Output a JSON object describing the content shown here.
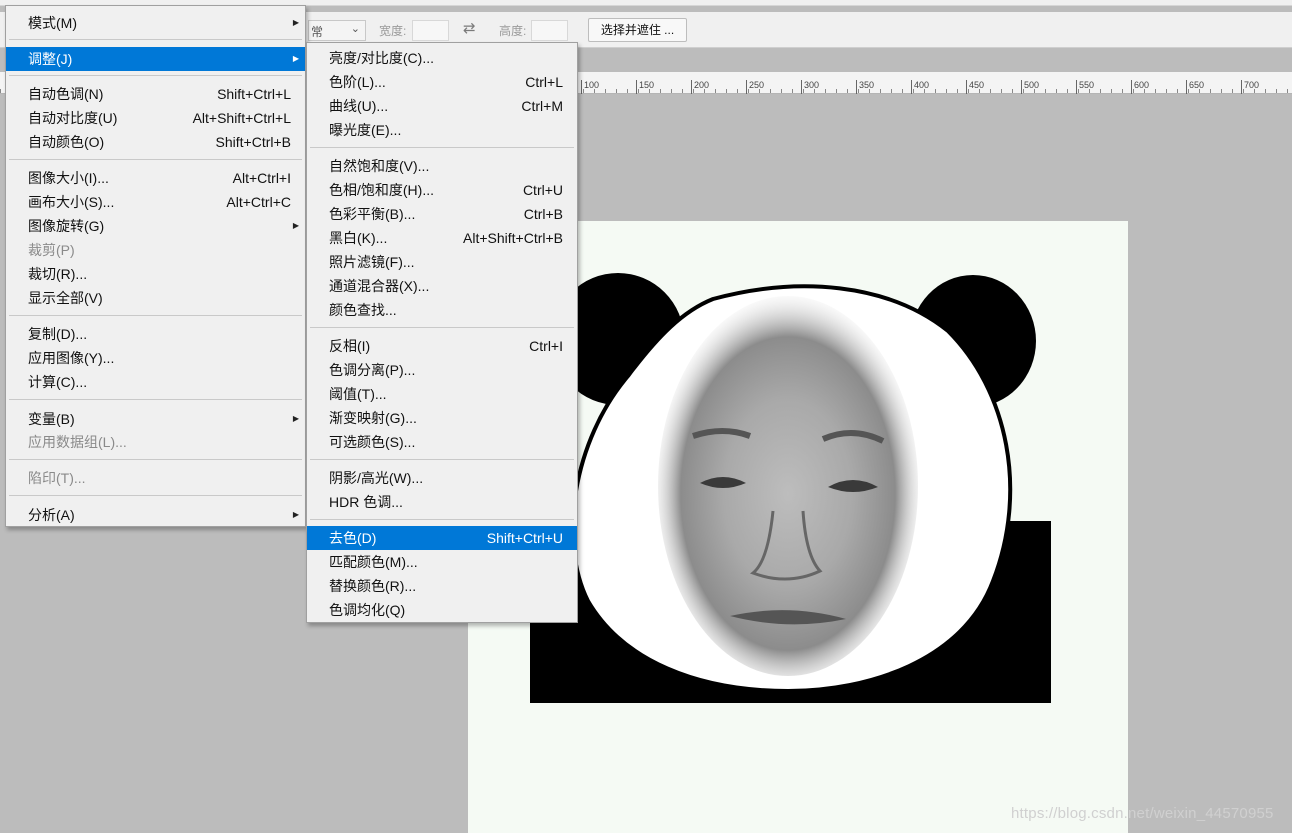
{
  "options_bar": {
    "style_value": "常",
    "width_label": "宽度:",
    "height_label": "高度:",
    "select_mask_button": "选择并遮住 ..."
  },
  "ruler": {
    "ticks": [
      "100",
      "150",
      "200",
      "250",
      "300",
      "350",
      "400",
      "450",
      "500",
      "550",
      "600",
      "650",
      "700"
    ]
  },
  "image_menu": {
    "items": [
      {
        "label": "模式(M)",
        "shortcut": "",
        "submenu": true,
        "disabled": false,
        "highlighted": false
      },
      {
        "label": "调整(J)",
        "shortcut": "",
        "submenu": true,
        "disabled": false,
        "highlighted": true
      },
      {
        "label": "自动色调(N)",
        "shortcut": "Shift+Ctrl+L",
        "submenu": false,
        "disabled": false,
        "highlighted": false
      },
      {
        "label": "自动对比度(U)",
        "shortcut": "Alt+Shift+Ctrl+L",
        "submenu": false,
        "disabled": false,
        "highlighted": false
      },
      {
        "label": "自动颜色(O)",
        "shortcut": "Shift+Ctrl+B",
        "submenu": false,
        "disabled": false,
        "highlighted": false
      },
      {
        "label": "图像大小(I)...",
        "shortcut": "Alt+Ctrl+I",
        "submenu": false,
        "disabled": false,
        "highlighted": false
      },
      {
        "label": "画布大小(S)...",
        "shortcut": "Alt+Ctrl+C",
        "submenu": false,
        "disabled": false,
        "highlighted": false
      },
      {
        "label": "图像旋转(G)",
        "shortcut": "",
        "submenu": true,
        "disabled": false,
        "highlighted": false
      },
      {
        "label": "裁剪(P)",
        "shortcut": "",
        "submenu": false,
        "disabled": true,
        "highlighted": false
      },
      {
        "label": "裁切(R)...",
        "shortcut": "",
        "submenu": false,
        "disabled": false,
        "highlighted": false
      },
      {
        "label": "显示全部(V)",
        "shortcut": "",
        "submenu": false,
        "disabled": false,
        "highlighted": false
      },
      {
        "label": "复制(D)...",
        "shortcut": "",
        "submenu": false,
        "disabled": false,
        "highlighted": false
      },
      {
        "label": "应用图像(Y)...",
        "shortcut": "",
        "submenu": false,
        "disabled": false,
        "highlighted": false
      },
      {
        "label": "计算(C)...",
        "shortcut": "",
        "submenu": false,
        "disabled": false,
        "highlighted": false
      },
      {
        "label": "变量(B)",
        "shortcut": "",
        "submenu": true,
        "disabled": false,
        "highlighted": false
      },
      {
        "label": "应用数据组(L)...",
        "shortcut": "",
        "submenu": false,
        "disabled": true,
        "highlighted": false
      },
      {
        "label": "陷印(T)...",
        "shortcut": "",
        "submenu": false,
        "disabled": true,
        "highlighted": false
      },
      {
        "label": "分析(A)",
        "shortcut": "",
        "submenu": true,
        "disabled": false,
        "highlighted": false
      }
    ]
  },
  "adjust_submenu": {
    "items": [
      {
        "label": "亮度/对比度(C)...",
        "shortcut": "",
        "highlighted": false
      },
      {
        "label": "色阶(L)...",
        "shortcut": "Ctrl+L",
        "highlighted": false
      },
      {
        "label": "曲线(U)...",
        "shortcut": "Ctrl+M",
        "highlighted": false
      },
      {
        "label": "曝光度(E)...",
        "shortcut": "",
        "highlighted": false
      },
      {
        "label": "自然饱和度(V)...",
        "shortcut": "",
        "highlighted": false
      },
      {
        "label": "色相/饱和度(H)...",
        "shortcut": "Ctrl+U",
        "highlighted": false
      },
      {
        "label": "色彩平衡(B)...",
        "shortcut": "Ctrl+B",
        "highlighted": false
      },
      {
        "label": "黑白(K)...",
        "shortcut": "Alt+Shift+Ctrl+B",
        "highlighted": false
      },
      {
        "label": "照片滤镜(F)...",
        "shortcut": "",
        "highlighted": false
      },
      {
        "label": "通道混合器(X)...",
        "shortcut": "",
        "highlighted": false
      },
      {
        "label": "颜色查找...",
        "shortcut": "",
        "highlighted": false
      },
      {
        "label": "反相(I)",
        "shortcut": "Ctrl+I",
        "highlighted": false
      },
      {
        "label": "色调分离(P)...",
        "shortcut": "",
        "highlighted": false
      },
      {
        "label": "阈值(T)...",
        "shortcut": "",
        "highlighted": false
      },
      {
        "label": "渐变映射(G)...",
        "shortcut": "",
        "highlighted": false
      },
      {
        "label": "可选颜色(S)...",
        "shortcut": "",
        "highlighted": false
      },
      {
        "label": "阴影/高光(W)...",
        "shortcut": "",
        "highlighted": false
      },
      {
        "label": "HDR 色调...",
        "shortcut": "",
        "highlighted": false
      },
      {
        "label": "去色(D)",
        "shortcut": "Shift+Ctrl+U",
        "highlighted": true
      },
      {
        "label": "匹配颜色(M)...",
        "shortcut": "",
        "highlighted": false
      },
      {
        "label": "替换颜色(R)...",
        "shortcut": "",
        "highlighted": false
      },
      {
        "label": "色调均化(Q)",
        "shortcut": "",
        "highlighted": false
      }
    ]
  },
  "watermark": "https://blog.csdn.net/weixin_44570955",
  "colors": {
    "highlight": "#0078d7",
    "menu_bg": "#f0f0f0",
    "workspace": "#bcbcbc"
  }
}
